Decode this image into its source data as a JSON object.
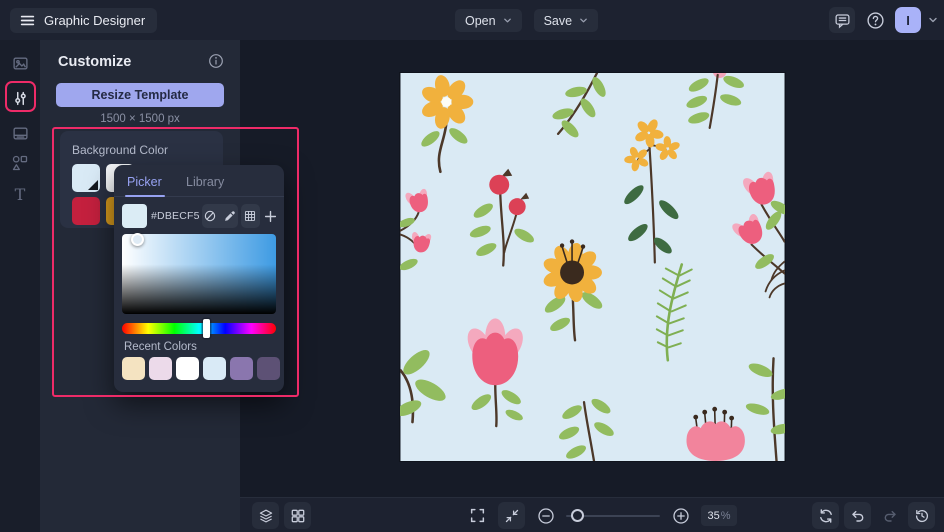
{
  "topbar": {
    "menu_icon": "hamburger-icon",
    "app_title": "Graphic Designer",
    "open_label": "Open",
    "save_label": "Save",
    "feedback_icon": "feedback-bubble-icon",
    "help_icon": "help-icon",
    "avatar_initial": "I"
  },
  "sidebar": {
    "items": [
      {
        "icon": "image-icon",
        "active": false
      },
      {
        "icon": "adjust-sliders-icon",
        "active": true
      },
      {
        "icon": "template-icon",
        "active": false
      },
      {
        "icon": "shapes-icon",
        "active": false
      },
      {
        "icon": "text-icon",
        "active": false
      }
    ]
  },
  "panel": {
    "title": "Customize",
    "info_icon": "info-icon",
    "resize_button_label": "Resize Template",
    "dimensions": "1500 × 1500 px",
    "background_color_label": "Background Color",
    "background_swatches": [
      "#D9EAF6",
      "#F6F8FA",
      "#C4203E",
      "#D89B1D"
    ]
  },
  "color_picker": {
    "tabs": [
      {
        "label": "Picker",
        "active": true
      },
      {
        "label": "Library",
        "active": false
      }
    ],
    "current_color": "#DBECF5",
    "hex_value": "#DBECF5",
    "tool_icons": [
      "no-color-icon",
      "eyedropper-icon",
      "swatch-grid-icon",
      "add-color-icon"
    ],
    "recent_colors_label": "Recent Colors",
    "recent_colors": [
      "#F4E3C1",
      "#ECDAEA",
      "#FFFFFF",
      "#D9EAF6",
      "#8A76AE",
      "#5D5175"
    ]
  },
  "canvas": {
    "background_color": "#DAEAF4",
    "artwork": "floral-pattern-with-yellow-daisies-pink-tulips-rose-hips-fern-and-leaf-branches"
  },
  "bottom_toolbar": {
    "left_tools": [
      "layers-icon",
      "grid-view-icon"
    ],
    "view_tools": [
      "fullscreen-icon",
      "fit-screen-icon"
    ],
    "zoom_out_icon": "minus-circle-icon",
    "zoom_in_icon": "plus-circle-icon",
    "zoom_value": "35",
    "zoom_unit": "%",
    "right_tools": [
      "reset-icon",
      "undo-icon",
      "redo-icon",
      "history-icon"
    ]
  },
  "colors": {
    "accent": "#9FA7EE",
    "annotation_pink": "#EE2B68",
    "topbar_bg": "#1D2230",
    "panel_bg": "#232937",
    "popup_bg": "#272D3D"
  }
}
